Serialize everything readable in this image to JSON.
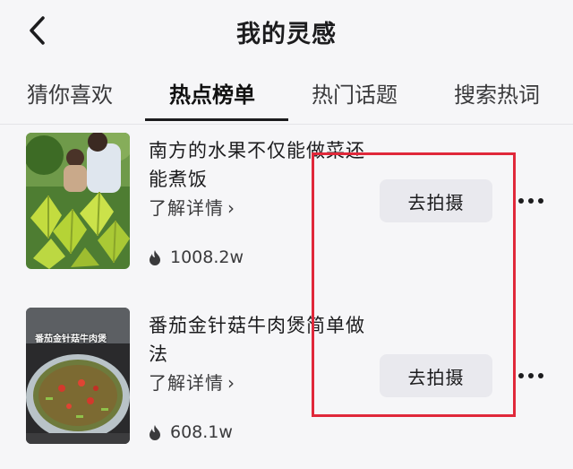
{
  "header": {
    "title": "我的灵感",
    "back_icon": "chevron-left-icon"
  },
  "tabs": [
    {
      "label": "猜你喜欢",
      "active": false
    },
    {
      "label": "热点榜单",
      "active": true
    },
    {
      "label": "热门话题",
      "active": false
    },
    {
      "label": "搜索热词",
      "active": false
    }
  ],
  "items": [
    {
      "title": "南方的水果不仅能做菜还能煮饭",
      "details_label": "了解详情",
      "chevron": "›",
      "views": "1008.2w",
      "shoot_label": "去拍摄",
      "thumbnail": "starfruit-couple-image"
    },
    {
      "title": "番茄金针菇牛肉煲简单做法",
      "details_label": "了解详情",
      "chevron": "›",
      "views": "608.1w",
      "shoot_label": "去拍摄",
      "thumbnail": "beef-stew-pot-image",
      "thumbnail_caption": "番茄金针菇牛肉煲"
    }
  ],
  "colors": {
    "highlight": "#e0283a",
    "active_tab": "#1c1c1e",
    "button_bg": "#e9e9ee"
  }
}
